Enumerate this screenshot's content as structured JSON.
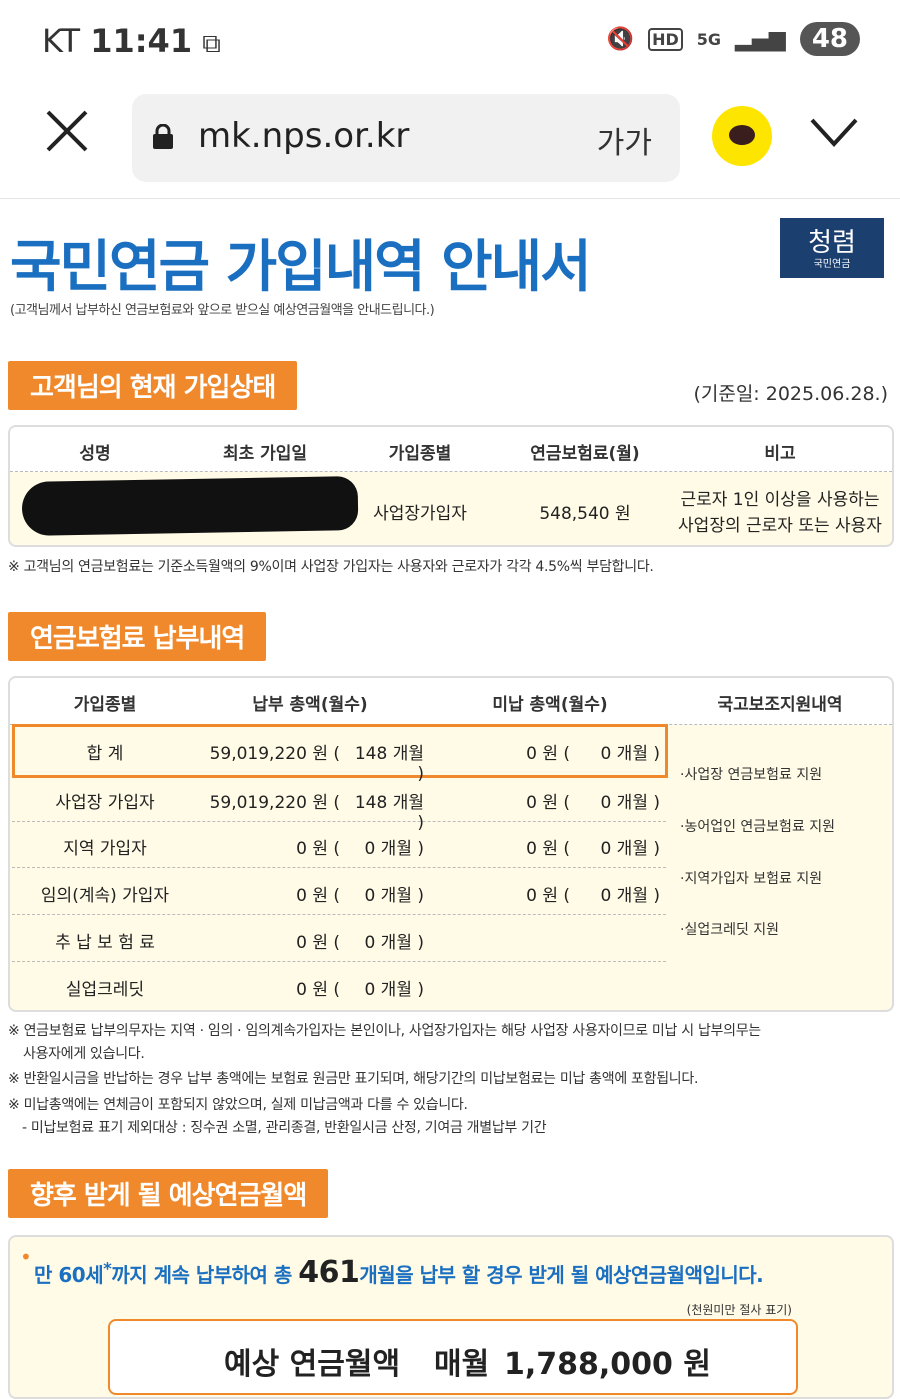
{
  "status_bar": {
    "carrier": "KT",
    "time": "11:41",
    "network": "5G",
    "hd": "HD",
    "battery": "48"
  },
  "browser": {
    "url": "mk.nps.or.kr",
    "text_size": "가가"
  },
  "doc": {
    "title": "국민연금 가입내역 안내서",
    "subtitle": "(고객님께서 납부하신 연금보험료와 앞으로 받으실 예상연금월액을 안내드립니다.)",
    "logo_main": "청렴",
    "logo_sub": "국민연금"
  },
  "section1": {
    "heading": "고객님의 현재 가입상태",
    "ref_date": "(기준일: 2025.06.28.)",
    "headers": [
      "성명",
      "최초 가입일",
      "가입종별",
      "연금보험료(월)",
      "비고"
    ],
    "row": {
      "type": "사업장가입자",
      "premium": "548,540 원",
      "remark_line1": "근로자 1인 이상을 사용하는",
      "remark_line2": "사업장의 근로자 또는 사용자"
    },
    "note": "※ 고객님의 연금보험료는 기준소득월액의 9%이며 사업장 가입자는 사용자와 근로자가 각각 4.5%씩 부담합니다."
  },
  "section2": {
    "heading": "연금보험료 납부내역",
    "headers": [
      "가입종별",
      "납부 총액(월수)",
      "미납 총액(월수)",
      "국고보조지원내역"
    ],
    "rows": [
      {
        "label": "합 계",
        "paid": "59,019,220 원 (",
        "paid_m": "148 개월 )",
        "unpaid": "0 원 (",
        "unpaid_m": "0 개월 )"
      },
      {
        "label": "사업장 가입자",
        "paid": "59,019,220 원 (",
        "paid_m": "148 개월 )",
        "unpaid": "0 원 (",
        "unpaid_m": "0 개월 )"
      },
      {
        "label": "지역 가입자",
        "paid": "0 원 (",
        "paid_m": "0 개월 )",
        "unpaid": "0 원 (",
        "unpaid_m": "0 개월 )"
      },
      {
        "label": "임의(계속) 가입자",
        "paid": "0 원 (",
        "paid_m": "0 개월 )",
        "unpaid": "0 원 (",
        "unpaid_m": "0 개월 )"
      },
      {
        "label": "추 납 보 험 료",
        "paid": "0 원 (",
        "paid_m": "0 개월 )",
        "unpaid": "",
        "unpaid_m": ""
      },
      {
        "label": "실업크레딧",
        "paid": "0 원 (",
        "paid_m": "0 개월 )",
        "unpaid": "",
        "unpaid_m": ""
      }
    ],
    "support": [
      "·사업장 연금보험료 지원",
      "·농어업인 연금보험료 지원",
      "·지역가입자 보험료 지원",
      "·실업크레딧 지원"
    ],
    "notes": [
      "※ 연금보험료 납부의무자는 지역 · 임의 · 임의계속가입자는 본인이나, 사업장가입자는 해당 사업장 사용자이므로 미납 시 납부의무는",
      "사용자에게 있습니다.",
      "※ 반환일시금을 반납하는 경우 납부 총액에는 보험료 원금만 표기되며, 해당기간의 미납보험료는 미납 총액에 포함됩니다.",
      "※ 미납총액에는 연체금이 포함되지 않았으며, 실제 미납금액과 다를 수 있습니다.",
      "- 미납보험료 표기 제외대상 : 징수권 소멸, 관리종결, 반환일시금 산정, 기여금 개별납부 기간"
    ]
  },
  "section3": {
    "heading": "향후 받게 될 예상연금월액",
    "text_prefix": "만 60세",
    "text_star": "*",
    "text_mid": "까지 계속 납부하여 총 ",
    "months": "461",
    "text_suffix": "개월을 납부 할 경우 받게 될 예상연금월액입니다.",
    "small_note": "(천원미만 절사 표기)",
    "result_label": "예상 연금월액",
    "result_monthly": "매월",
    "result_amount": "1,788,000 원"
  }
}
